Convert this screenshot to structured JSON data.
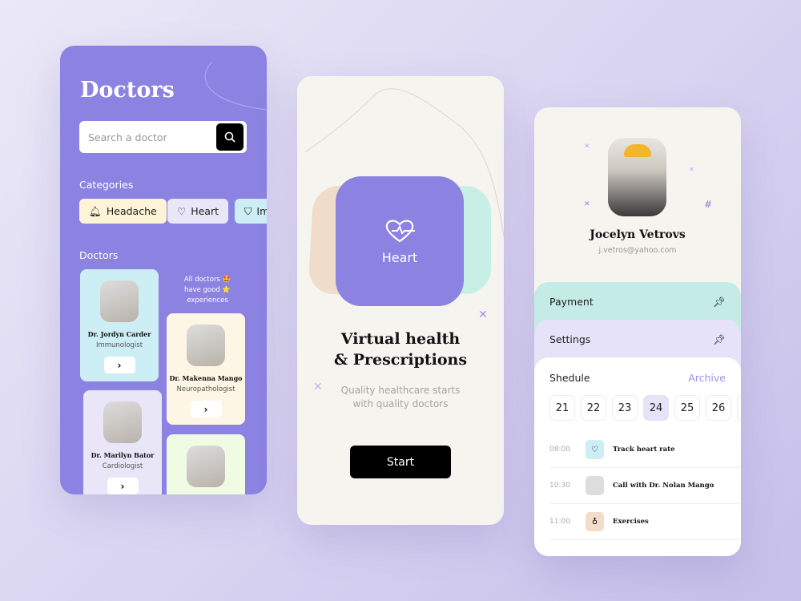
{
  "doctors_screen": {
    "title": "Doctors",
    "search_placeholder": "Search a doctor",
    "categories_label": "Categories",
    "categories": [
      {
        "label": "Headache",
        "icon": "bell-icon",
        "color": "#fdf3d6"
      },
      {
        "label": "Heart",
        "icon": "heart-icon",
        "color": "#e9e6f8"
      },
      {
        "label": "Im",
        "icon": "shield-icon",
        "color": "#cdeef4"
      }
    ],
    "doctors_label": "Doctors",
    "note": "All doctors 🤩 have good ⭐ experiences",
    "doctors": [
      {
        "name": "Dr. Jordyn Carder",
        "specialty": "Immunologist",
        "color": "#cdeef4"
      },
      {
        "name": "Dr. Makenna Mango",
        "specialty": "Neuropathologist",
        "color": "#fdf6e4"
      },
      {
        "name": "Dr. Marilyn Bator",
        "specialty": "Cardiologist",
        "color": "#e9e6f8"
      },
      {
        "name": "",
        "specialty": "",
        "color": "#f0fbe4"
      }
    ]
  },
  "onboarding": {
    "category": "Heart",
    "title_line1": "Virtual health",
    "title_line2": "& Prescriptions",
    "subtitle_line1": "Quality healthcare starts",
    "subtitle_line2": "with quality doctors",
    "start": "Start",
    "accent": "#8b82e1"
  },
  "profile": {
    "name": "Jocelyn Vetrovs",
    "email": "j.vetros@yahoo.com",
    "payment": "Payment",
    "settings": "Settings",
    "schedule": "Shedule",
    "archive": "Archive",
    "days": [
      "21",
      "22",
      "23",
      "24",
      "25",
      "26"
    ],
    "selected_day": "24",
    "events": [
      {
        "time": "08:00",
        "title": "Track heart rate",
        "icon": "heart-pulse-icon",
        "color": "#cdeef4"
      },
      {
        "time": "10:30",
        "title": "Call with Dr. Nolan Mango",
        "icon": "avatar",
        "color": "#ddd"
      },
      {
        "time": "11:00",
        "title": "Exercises",
        "icon": "flame-icon",
        "color": "#f3dccb"
      }
    ]
  }
}
